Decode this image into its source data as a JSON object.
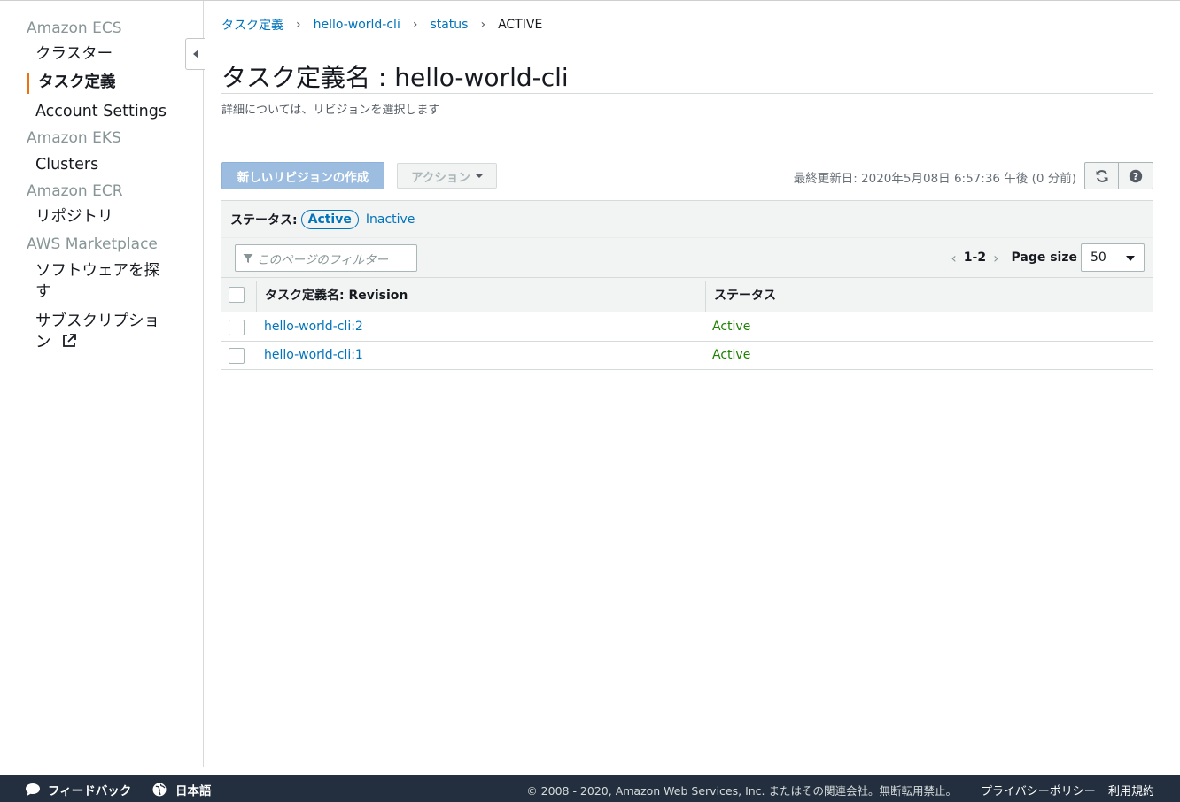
{
  "sidebar": {
    "sections": [
      {
        "title": "Amazon ECS",
        "items": [
          {
            "label": "クラスター"
          },
          {
            "label": "タスク定義",
            "active": true
          },
          {
            "label": "Account Settings"
          }
        ]
      },
      {
        "title": "Amazon EKS",
        "items": [
          {
            "label": "Clusters"
          }
        ]
      },
      {
        "title": "Amazon ECR",
        "items": [
          {
            "label": "リポジトリ"
          }
        ]
      },
      {
        "title": "AWS Marketplace",
        "items": [
          {
            "label_line1": "ソフトウェアを探",
            "label_line2": "す"
          },
          {
            "label_line1": "サブスクリプショ",
            "label_line2": "ン",
            "external": true
          }
        ]
      }
    ]
  },
  "breadcrumb": [
    {
      "label": "タスク定義",
      "link": true
    },
    {
      "label": "hello-world-cli",
      "link": true
    },
    {
      "label": "status",
      "link": true
    },
    {
      "label": "ACTIVE",
      "link": false
    }
  ],
  "page": {
    "title": "タスク定義名 : hello-world-cli",
    "subtitle": "詳細については、リビジョンを選択します"
  },
  "toolbar": {
    "create_label": "新しいリビジョンの作成",
    "actions_label": "アクション",
    "last_updated": "最終更新日: 2020年5月08日 6:57:36 午後 (0 分前)"
  },
  "status_filter": {
    "label": "ステータス:",
    "active": "Active",
    "inactive": "Inactive"
  },
  "filter": {
    "placeholder": "このページのフィルター"
  },
  "pager": {
    "range": "1-2",
    "page_size_label": "Page size",
    "page_size": "50"
  },
  "table": {
    "columns": [
      "タスク定義名: Revision",
      "ステータス"
    ],
    "rows": [
      {
        "name": "hello-world-cli:2",
        "status": "Active"
      },
      {
        "name": "hello-world-cli:1",
        "status": "Active"
      }
    ]
  },
  "footer": {
    "feedback": "フィードバック",
    "language": "日本語",
    "copyright": "© 2008 - 2020, Amazon Web Services, Inc. またはその関連会社。無断転用禁止。",
    "privacy": "プライバシーポリシー",
    "terms": "利用規約"
  },
  "colors": {
    "link": "#0073bb",
    "active_status": "#1d8102",
    "accent": "#ec7211",
    "footer_bg": "#232f3e"
  }
}
